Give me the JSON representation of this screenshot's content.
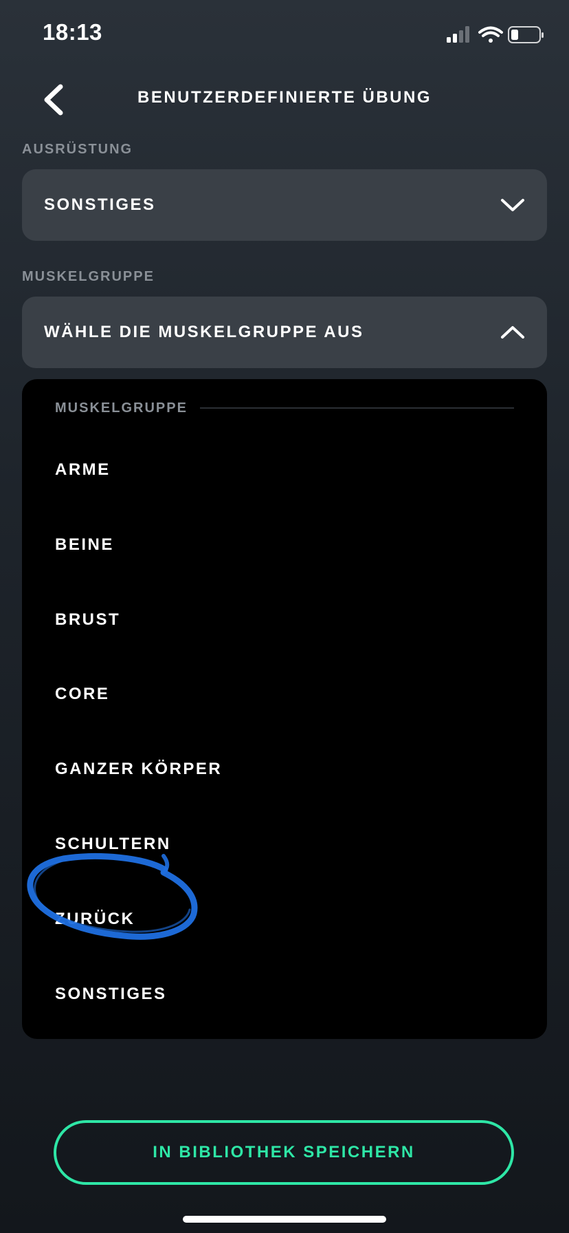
{
  "status_bar": {
    "time": "18:13"
  },
  "header": {
    "title": "BENUTZERDEFINIERTE ÜBUNG"
  },
  "equipment": {
    "label": "AUSRÜSTUNG",
    "value": "SONSTIGES"
  },
  "muscle_group": {
    "label": "MUSKELGRUPPE",
    "value": "WÄHLE DIE MUSKELGRUPPE AUS"
  },
  "dropdown": {
    "header": "MUSKELGRUPPE",
    "options": [
      {
        "label": "ARME"
      },
      {
        "label": "BEINE"
      },
      {
        "label": "BRUST"
      },
      {
        "label": "CORE"
      },
      {
        "label": "GANZER KÖRPER"
      },
      {
        "label": "SCHULTERN"
      },
      {
        "label": "ZURÜCK"
      },
      {
        "label": "SONSTIGES"
      }
    ]
  },
  "footer": {
    "save_label": "IN BIBLIOTHEK SPEICHERN"
  },
  "colors": {
    "accent": "#2ee6a6",
    "annotation": "#1f6fe0",
    "select_bg": "#3a4047",
    "panel_bg": "#000000",
    "muted_text": "#8a9097"
  },
  "icons": {
    "back": "chevron-left-icon",
    "equipment_toggle": "chevron-down-icon",
    "muscle_toggle": "chevron-up-icon",
    "signal": "signal-icon",
    "wifi": "wifi-icon",
    "battery": "battery-icon"
  }
}
